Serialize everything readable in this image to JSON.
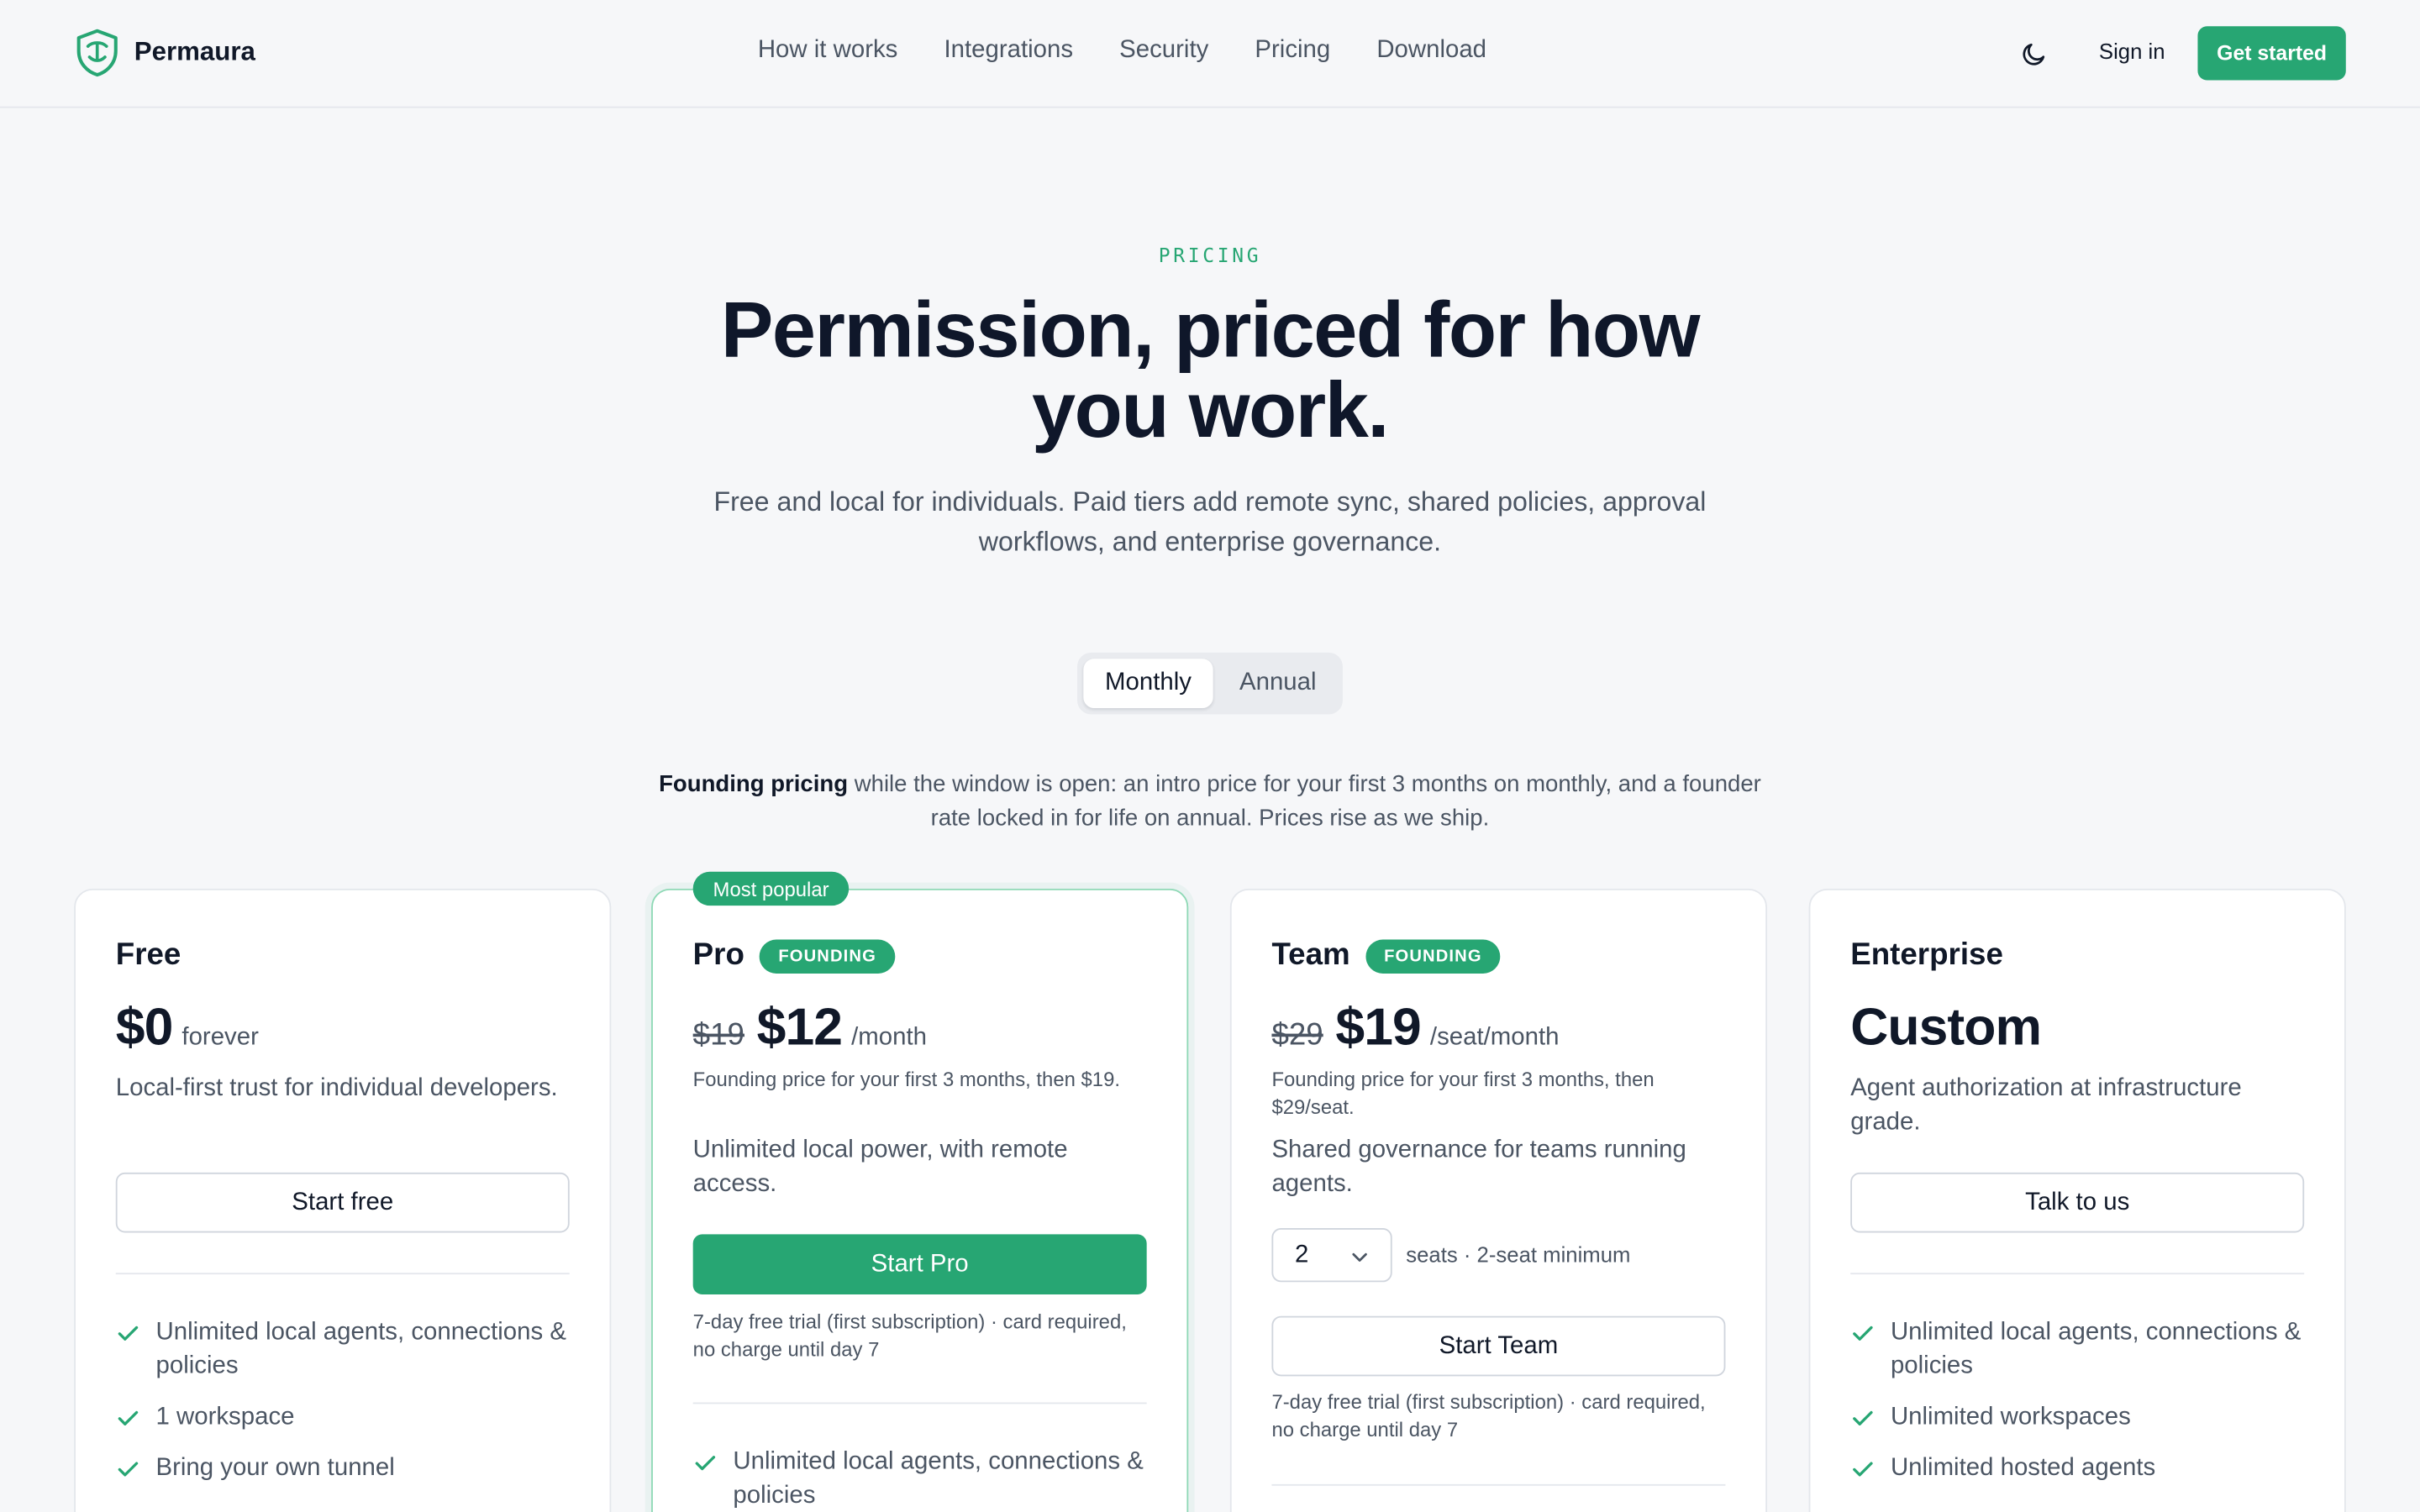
{
  "brand": {
    "name": "Permaura",
    "accent": "#27a673"
  },
  "nav": {
    "items": [
      "How it works",
      "Integrations",
      "Security",
      "Pricing",
      "Download"
    ],
    "theme_icon": "moon-icon",
    "sign_in": "Sign in",
    "get_started": "Get started"
  },
  "hero": {
    "eyebrow": "PRICING",
    "title": "Permission, priced for how you work.",
    "subtitle": "Free and local for individuals. Paid tiers add remote sync, shared policies, approval workflows, and enterprise governance."
  },
  "billing_toggle": {
    "monthly": "Monthly",
    "annual": "Annual",
    "selected": "Monthly"
  },
  "founding_note": {
    "lead": "Founding pricing",
    "rest": " while the window is open: an intro price for your first 3 months on monthly, and a founder rate locked in for life on annual. Prices rise as we ship."
  },
  "plans": {
    "free": {
      "name": "Free",
      "price": "$0",
      "period": "forever",
      "description": "Local-first trust for individual developers.",
      "cta": "Start free",
      "features": [
        "Unlimited local agents, connections & policies",
        "1 workspace",
        "Bring your own tunnel"
      ]
    },
    "pro": {
      "badge": "Most popular",
      "name": "Pro",
      "tag": "FOUNDING",
      "old_price": "$19",
      "price": "$12",
      "period": "/month",
      "price_note": "Founding price for your first 3 months, then $19.",
      "description": "Unlimited local power, with remote access.",
      "cta": "Start Pro",
      "trial_note": "7-day free trial (first subscription) · card required, no charge until day 7",
      "features": [
        "Unlimited local agents, connections & policies"
      ]
    },
    "team": {
      "name": "Team",
      "tag": "FOUNDING",
      "old_price": "$29",
      "price": "$19",
      "period": "/seat/month",
      "price_note": "Founding price for your first 3 months, then $29/seat.",
      "description": "Shared governance for teams running agents.",
      "seats_value": "2",
      "seats_note": "seats · 2-seat minimum",
      "cta": "Start Team",
      "trial_note": "7-day free trial (first subscription) · card required, no charge until day 7"
    },
    "enterprise": {
      "name": "Enterprise",
      "price": "Custom",
      "description": "Agent authorization at infrastructure grade.",
      "cta": "Talk to us",
      "features": [
        "Unlimited local agents, connections & policies",
        "Unlimited workspaces",
        "Unlimited hosted agents"
      ]
    }
  }
}
